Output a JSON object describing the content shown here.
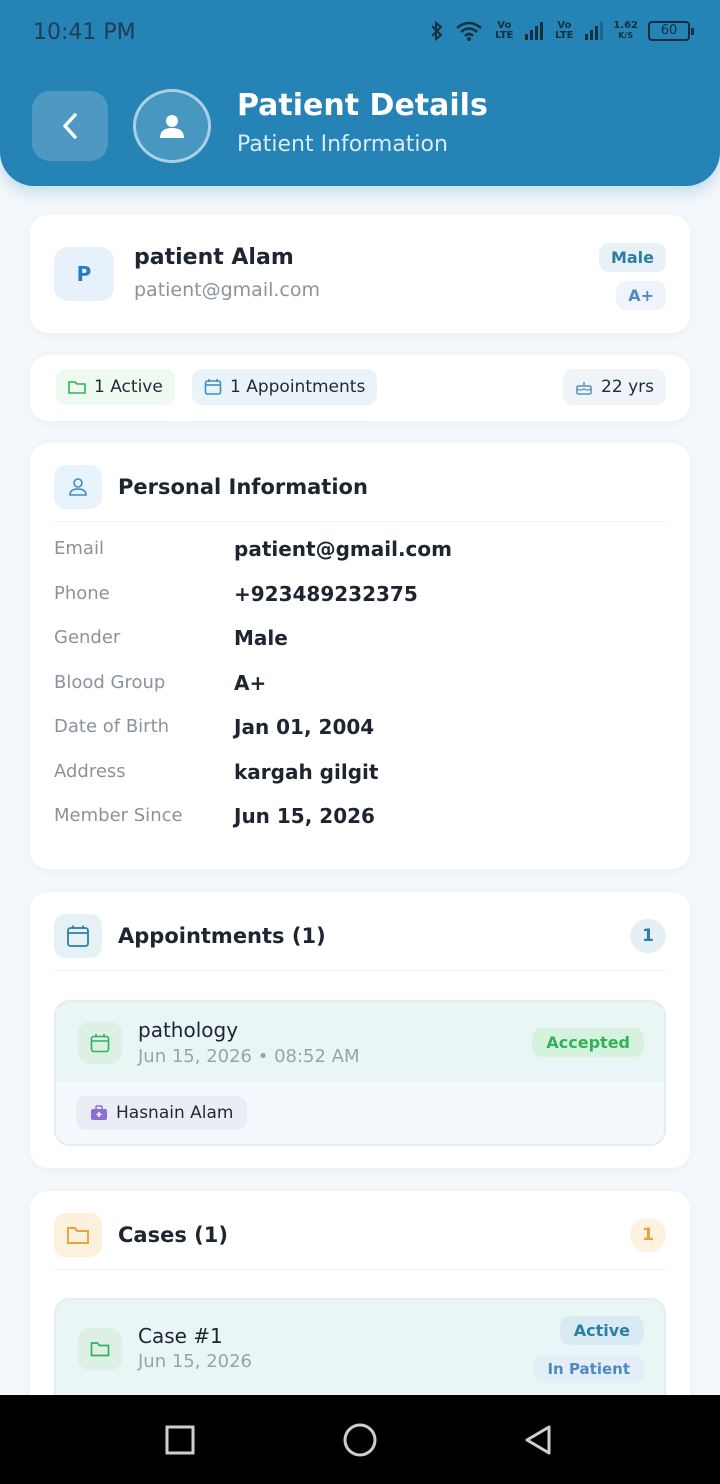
{
  "status_bar": {
    "time": "10:41 PM",
    "net_speed_value": "1.62",
    "net_speed_unit": "K/S",
    "battery": "60",
    "lte1": "Vo LTE",
    "lte2": "Vo LTE"
  },
  "header": {
    "title": "Patient Details",
    "subtitle": "Patient Information"
  },
  "patient": {
    "initial": "P",
    "name": "patient Alam",
    "email": "patient@gmail.com",
    "gender_tag": "Male",
    "blood_tag": "A+"
  },
  "stats": {
    "active": "1 Active",
    "appointments": "1 Appointments",
    "age": "22 yrs"
  },
  "personal_info": {
    "title": "Personal Information",
    "rows": [
      {
        "label": "Email",
        "value": "patient@gmail.com"
      },
      {
        "label": "Phone",
        "value": "+923489232375"
      },
      {
        "label": "Gender",
        "value": "Male"
      },
      {
        "label": "Blood Group",
        "value": "A+"
      },
      {
        "label": "Date of Birth",
        "value": "Jan 01, 2004"
      },
      {
        "label": "Address",
        "value": "kargah gilgit"
      },
      {
        "label": "Member Since",
        "value": "Jun 15, 2026"
      }
    ]
  },
  "appointments_section": {
    "title": "Appointments (1)",
    "count": "1",
    "items": [
      {
        "title": "pathology",
        "datetime": "Jun 15, 2026 • 08:52 AM",
        "status": "Accepted",
        "doctor": "Hasnain Alam"
      }
    ]
  },
  "cases_section": {
    "title": "Cases (1)",
    "count": "1",
    "items": [
      {
        "title": "Case #1",
        "date": "Jun 15, 2026",
        "status": "Active",
        "type": "In Patient"
      }
    ]
  },
  "colors": {
    "primary": "#2683b5",
    "accent_green": "#2fb35a",
    "accent_orange": "#e8a23a"
  },
  "icons": {
    "back": "chevron-left-icon",
    "avatar": "person-icon",
    "folder": "folder-icon",
    "calendar": "calendar-icon",
    "cake": "cake-icon",
    "doctor": "medical-bag-icon"
  }
}
